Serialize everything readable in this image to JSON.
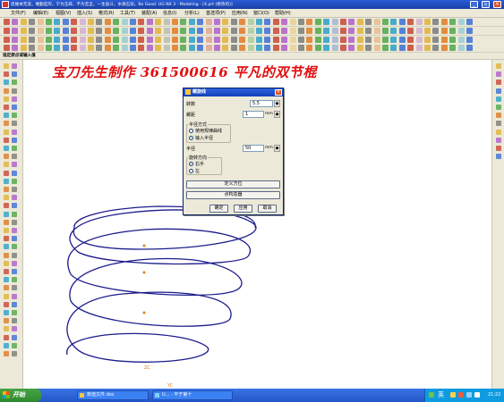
{
  "window": {
    "title": "思维本无涯，唯勤是岸。宁为玉碎，不为瓦全。一生奋斗，水滴石穿。Be Good.  UG NX 3 - Modeling - [4.prt  (修改的)]"
  },
  "menu": [
    "文件(F)",
    "编辑(E)",
    "视图(V)",
    "插入(S)",
    "格式(R)",
    "工具(T)",
    "装配(A)",
    "信息(I)",
    "分析(L)",
    "首选项(P)",
    "应用(N)",
    "窗口(O)",
    "帮助(H)"
  ],
  "status_line": "指定原点或输入值",
  "watermark": "宝刀先生制作 361500616 平凡的双节棍",
  "dialog": {
    "title": "螺旋线",
    "turns_label": "转数",
    "turns_value": "5.5",
    "pitch_label": "螺距",
    "pitch_value": "1",
    "pitch_unit": "mm",
    "radius_group_label": "半径方式",
    "radius_option_law": "使用规律曲线",
    "radius_option_input": "输入半径",
    "radius_label": "半径",
    "radius_value": "50",
    "radius_unit": "mm",
    "direction_group_label": "旋转方向",
    "direction_right": "右手",
    "direction_left": "左",
    "define_orientation_button": "定义方位",
    "point_constructor_button": "点构造器",
    "ok_button": "确定",
    "apply_button": "应用",
    "cancel_button": "取消",
    "selected_radius_mode": "input",
    "selected_direction": "right"
  },
  "viewport": {
    "label_zc": "ZC",
    "label_yc": "YC",
    "curve_color": "#1c1c8c",
    "point_color": "#e0801a"
  },
  "taskbar": {
    "start_label": "开始",
    "tasks": [
      "数值文件.doc",
      "U... - 平于第十"
    ],
    "language": "英",
    "clock": "21:22"
  },
  "colors": {
    "watermark": "#e01010",
    "titlebar": "#1941a5",
    "taskbar": "#2456c7"
  }
}
